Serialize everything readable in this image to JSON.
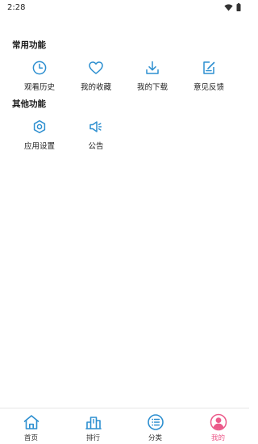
{
  "status_bar": {
    "time": "2:28"
  },
  "colors": {
    "accent_blue": "#2d8fd0",
    "active_pink": "#ec5a8a"
  },
  "sections": [
    {
      "title": "常用功能",
      "items": [
        {
          "label": "观看历史",
          "icon": "clock-icon"
        },
        {
          "label": "我的收藏",
          "icon": "heart-icon"
        },
        {
          "label": "我的下载",
          "icon": "download-icon"
        },
        {
          "label": "意见反馈",
          "icon": "feedback-edit-icon"
        }
      ]
    },
    {
      "title": "其他功能",
      "items": [
        {
          "label": "应用设置",
          "icon": "settings-icon"
        },
        {
          "label": "公告",
          "icon": "speaker-icon"
        }
      ]
    }
  ],
  "bottom_nav": [
    {
      "label": "首页",
      "icon": "home-icon",
      "active": false
    },
    {
      "label": "排行",
      "icon": "ranking-icon",
      "active": false
    },
    {
      "label": "分类",
      "icon": "category-list-icon",
      "active": false
    },
    {
      "label": "我的",
      "icon": "profile-icon",
      "active": true
    }
  ]
}
